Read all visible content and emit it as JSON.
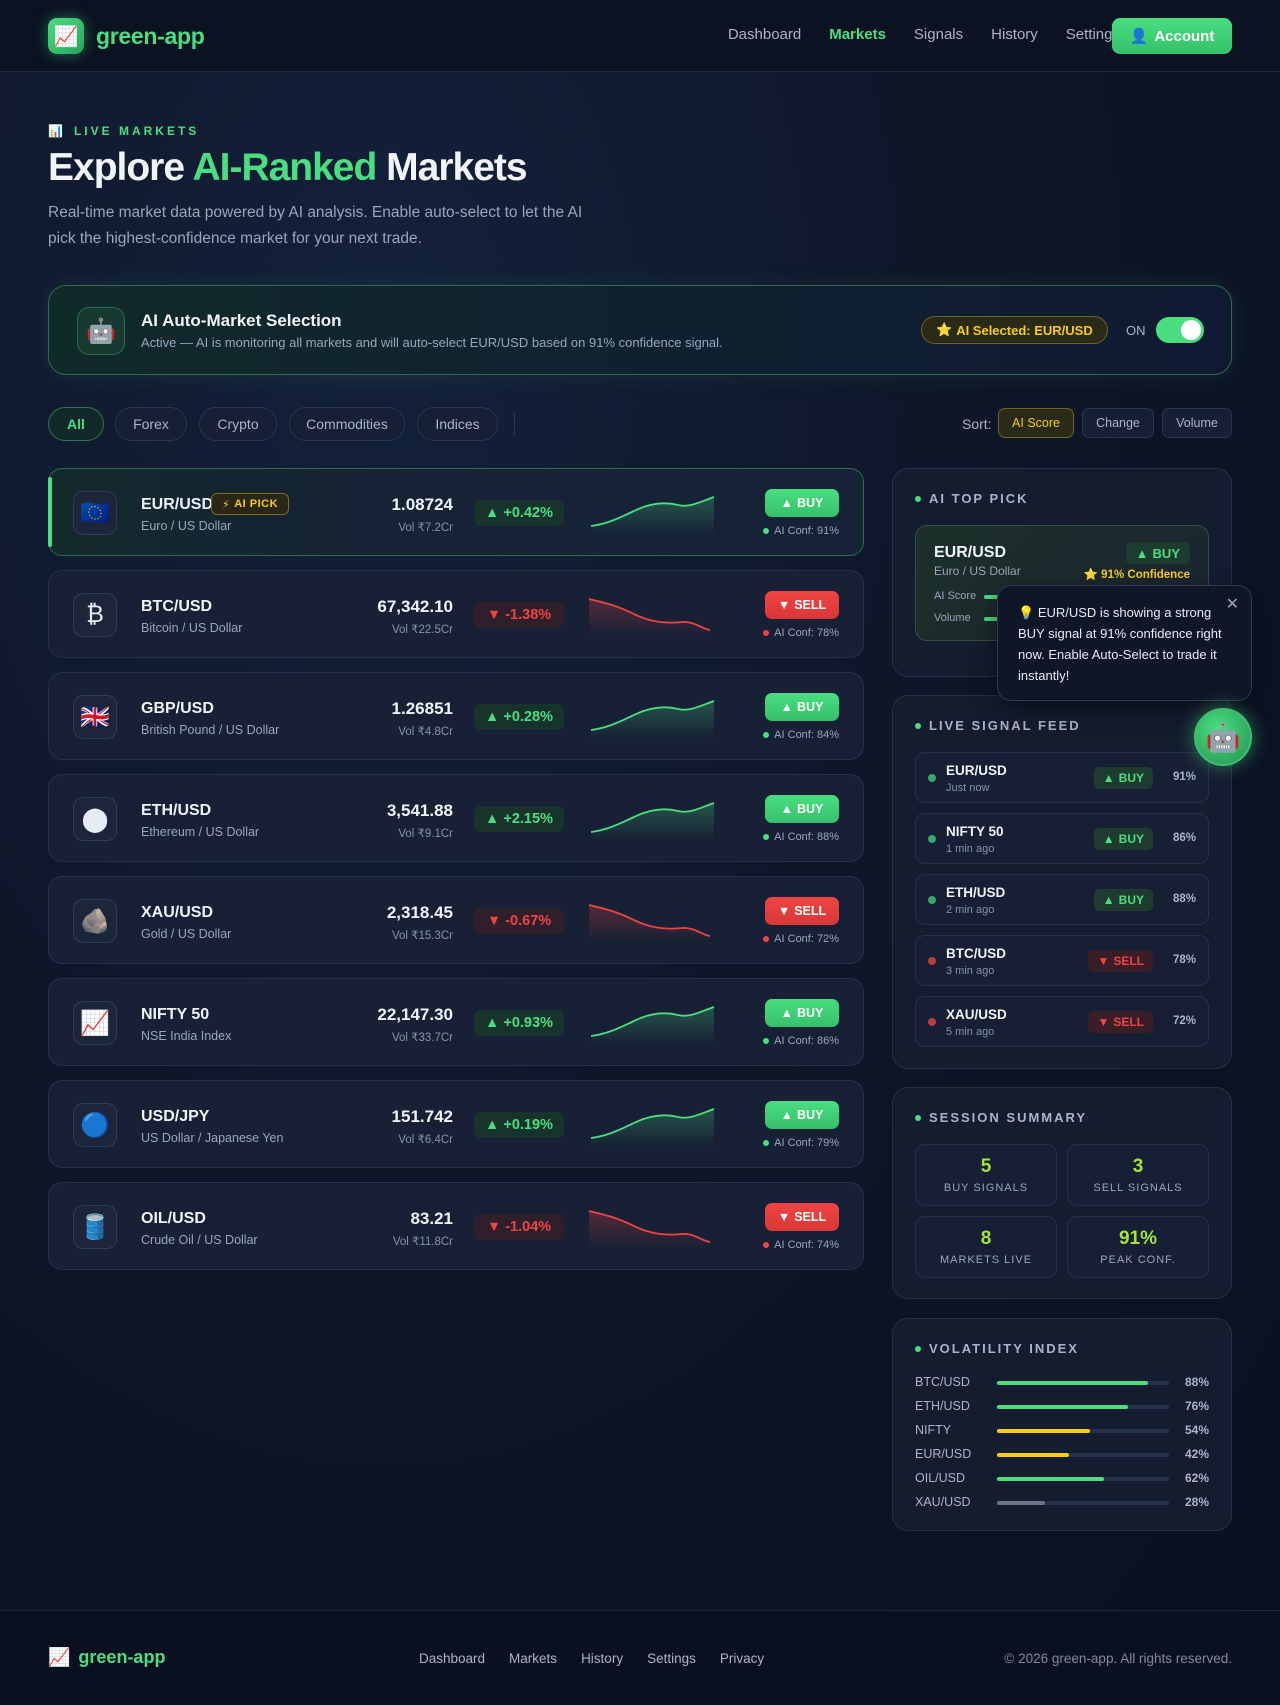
{
  "nav": {
    "logo_text": "green-app",
    "links": [
      "Dashboard",
      "Markets",
      "Signals",
      "History",
      "Settings"
    ],
    "active_link": "Markets",
    "account_label": "Account"
  },
  "hero": {
    "eyebrow": "LIVE MARKETS",
    "title_pre": "Explore ",
    "title_highlight": "AI-Ranked",
    "title_post": " Markets",
    "subtitle": "Real-time market data powered by AI analysis. Enable auto-select to let the AI pick the highest-confidence market for your next trade."
  },
  "banner": {
    "title": "AI Auto-Market Selection",
    "desc": "Active — AI is monitoring all markets and will auto-select EUR/USD based on 91% confidence signal.",
    "selected_badge": "AI Selected: EUR/USD",
    "toggle_label": "ON",
    "toggle_on": true
  },
  "filters": {
    "chips": [
      "All",
      "Forex",
      "Crypto",
      "Commodities",
      "Indices"
    ],
    "active_chip": "All",
    "sort_label": "Sort:",
    "sort_options": [
      "AI Score",
      "Change",
      "Volume"
    ],
    "active_sort": "AI Score"
  },
  "markets": [
    {
      "symbol": "EUR/USD",
      "name": "Euro / US Dollar",
      "icon": "eu-flag-icon",
      "glyph": "🇪🇺",
      "price": "1.08724",
      "volume": "Vol ₹7.2Cr",
      "change": "+0.42%",
      "direction": "up",
      "signal": "BUY",
      "confidence": "AI Conf: 91%",
      "ai_pick": "AI PICK"
    },
    {
      "symbol": "BTC/USD",
      "name": "Bitcoin / US Dollar",
      "icon": "bitcoin-icon",
      "glyph": "₿",
      "price": "67,342.10",
      "volume": "Vol ₹22.5Cr",
      "change": "-1.38%",
      "direction": "down",
      "signal": "SELL",
      "confidence": "AI Conf: 78%"
    },
    {
      "symbol": "GBP/USD",
      "name": "British Pound / US Dollar",
      "icon": "uk-flag-icon",
      "glyph": "🇬🇧",
      "price": "1.26851",
      "volume": "Vol ₹4.8Cr",
      "change": "+0.28%",
      "direction": "up",
      "signal": "BUY",
      "confidence": "AI Conf: 84%"
    },
    {
      "symbol": "ETH/USD",
      "name": "Ethereum / US Dollar",
      "icon": "ethereum-icon",
      "glyph": "⬤",
      "price": "3,541.88",
      "volume": "Vol ₹9.1Cr",
      "change": "+2.15%",
      "direction": "up",
      "signal": "BUY",
      "confidence": "AI Conf: 88%"
    },
    {
      "symbol": "XAU/USD",
      "name": "Gold / US Dollar",
      "icon": "gold-rock-icon",
      "glyph": "🪨",
      "price": "2,318.45",
      "volume": "Vol ₹15.3Cr",
      "change": "-0.67%",
      "direction": "down",
      "signal": "SELL",
      "confidence": "AI Conf: 72%"
    },
    {
      "symbol": "NIFTY 50",
      "name": "NSE India Index",
      "icon": "chart-up-icon",
      "glyph": "📈",
      "price": "22,147.30",
      "volume": "Vol ₹33.7Cr",
      "change": "+0.93%",
      "direction": "up",
      "signal": "BUY",
      "confidence": "AI Conf: 86%"
    },
    {
      "symbol": "USD/JPY",
      "name": "US Dollar / Japanese Yen",
      "icon": "blue-circle-icon",
      "glyph": "🔵",
      "price": "151.742",
      "volume": "Vol ₹6.4Cr",
      "change": "+0.19%",
      "direction": "up",
      "signal": "BUY",
      "confidence": "AI Conf: 79%"
    },
    {
      "symbol": "OIL/USD",
      "name": "Crude Oil / US Dollar",
      "icon": "oil-barrel-icon",
      "glyph": "🛢️",
      "price": "83.21",
      "volume": "Vol ₹11.8Cr",
      "change": "-1.04%",
      "direction": "down",
      "signal": "SELL",
      "confidence": "AI Conf: 74%"
    }
  ],
  "top_pick": {
    "title": "AI TOP PICK",
    "symbol": "EUR/USD",
    "name": "Euro / US Dollar",
    "signal": "BUY",
    "confidence": "91% Confidence",
    "rows": [
      {
        "label": "AI Score",
        "level": 0.91
      },
      {
        "label": "Volume",
        "level": 0.6
      }
    ]
  },
  "tooltip": {
    "text": "EUR/USD is showing a strong BUY signal at 91% confidence right now. Enable Auto-Select to trade it instantly!",
    "close": "✕"
  },
  "signal_feed": {
    "title": "LIVE SIGNAL FEED",
    "items": [
      {
        "symbol": "EUR/USD",
        "time": "Just now",
        "signal": "BUY",
        "pct": "91%"
      },
      {
        "symbol": "NIFTY 50",
        "time": "1 min ago",
        "signal": "BUY",
        "pct": "86%"
      },
      {
        "symbol": "ETH/USD",
        "time": "2 min ago",
        "signal": "BUY",
        "pct": "88%"
      },
      {
        "symbol": "BTC/USD",
        "time": "3 min ago",
        "signal": "SELL",
        "pct": "78%"
      },
      {
        "symbol": "XAU/USD",
        "time": "5 min ago",
        "signal": "SELL",
        "pct": "72%"
      }
    ]
  },
  "session": {
    "title": "SESSION SUMMARY",
    "stats": [
      {
        "value": "5",
        "label": "BUY SIGNALS"
      },
      {
        "value": "3",
        "label": "SELL SIGNALS"
      },
      {
        "value": "8",
        "label": "MARKETS LIVE"
      },
      {
        "value": "91%",
        "label": "PEAK CONF."
      }
    ]
  },
  "volatility": {
    "title": "VOLATILITY INDEX",
    "items": [
      {
        "label": "BTC/USD",
        "pct": "88%",
        "level": 0.88,
        "color": "#4ade80"
      },
      {
        "label": "ETH/USD",
        "pct": "76%",
        "level": 0.76,
        "color": "#4ade80"
      },
      {
        "label": "NIFTY",
        "pct": "54%",
        "level": 0.54,
        "color": "#facc15"
      },
      {
        "label": "EUR/USD",
        "pct": "42%",
        "level": 0.42,
        "color": "#facc15"
      },
      {
        "label": "OIL/USD",
        "pct": "62%",
        "level": 0.62,
        "color": "#4ade80"
      },
      {
        "label": "XAU/USD",
        "pct": "28%",
        "level": 0.28,
        "color": "#6b7385"
      }
    ]
  },
  "footer": {
    "logo_text": "green-app",
    "links": [
      "Dashboard",
      "Markets",
      "History",
      "Settings",
      "Privacy"
    ],
    "copyright": "© 2026 green-app. All rights reserved."
  },
  "colors": {
    "accent": "#4ade80",
    "sell": "#ef4444",
    "highlight": "#facc15"
  }
}
